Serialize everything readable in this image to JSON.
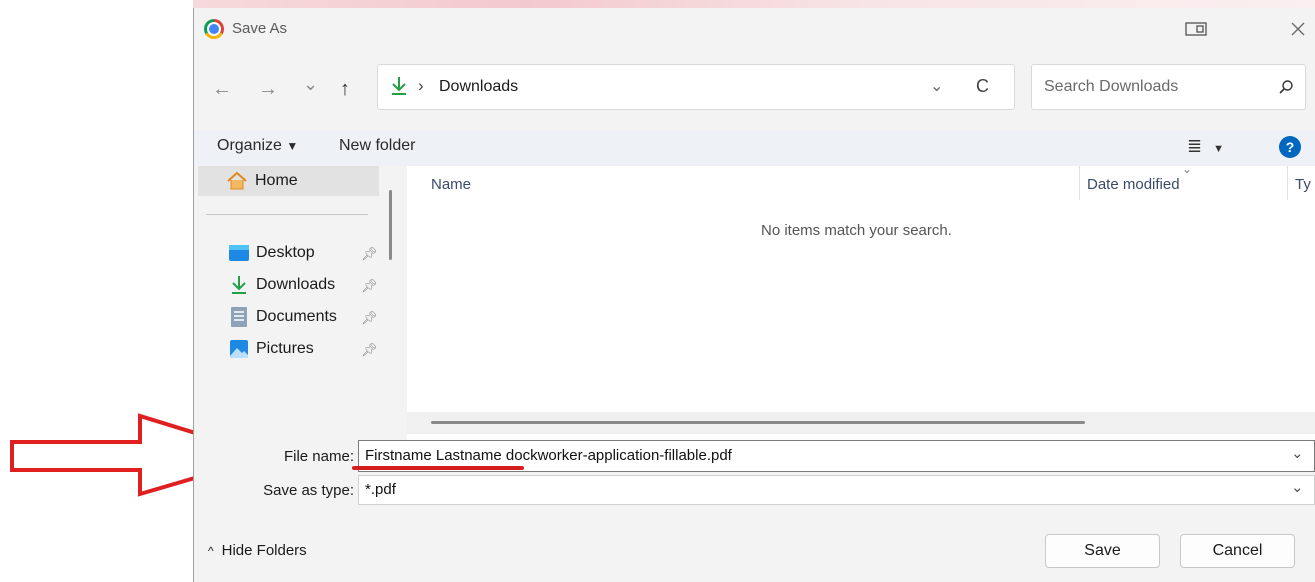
{
  "dialog": {
    "title": "Save As"
  },
  "nav": {
    "back": "←",
    "forward": "→",
    "recent": "⌄",
    "up": "↑",
    "path": "Downloads",
    "separator": "›",
    "refresh": "C",
    "search_placeholder": "Search Downloads"
  },
  "toolbar": {
    "organize": "Organize",
    "new_folder": "New folder"
  },
  "sidebar": {
    "home": "Home",
    "items": [
      {
        "label": "Desktop",
        "icon": "desktop-icon"
      },
      {
        "label": "Downloads",
        "icon": "download-icon"
      },
      {
        "label": "Documents",
        "icon": "document-icon"
      },
      {
        "label": "Pictures",
        "icon": "pictures-icon"
      }
    ]
  },
  "list": {
    "col_name": "Name",
    "col_date": "Date modified",
    "col_type_partial": "Ty",
    "empty": "No items match your search."
  },
  "form": {
    "file_name_label": "File name:",
    "file_name_value": "Firstname Lastname dockworker-application-fillable.pdf",
    "save_type_label": "Save as type:",
    "save_type_value": "*.pdf"
  },
  "footer": {
    "hide_folders": "Hide Folders",
    "save": "Save",
    "cancel": "Cancel"
  },
  "colors": {
    "arrow": "#e02020",
    "underline": "#d41e1e",
    "accent_blue": "#0067c0",
    "green": "#22a046"
  }
}
